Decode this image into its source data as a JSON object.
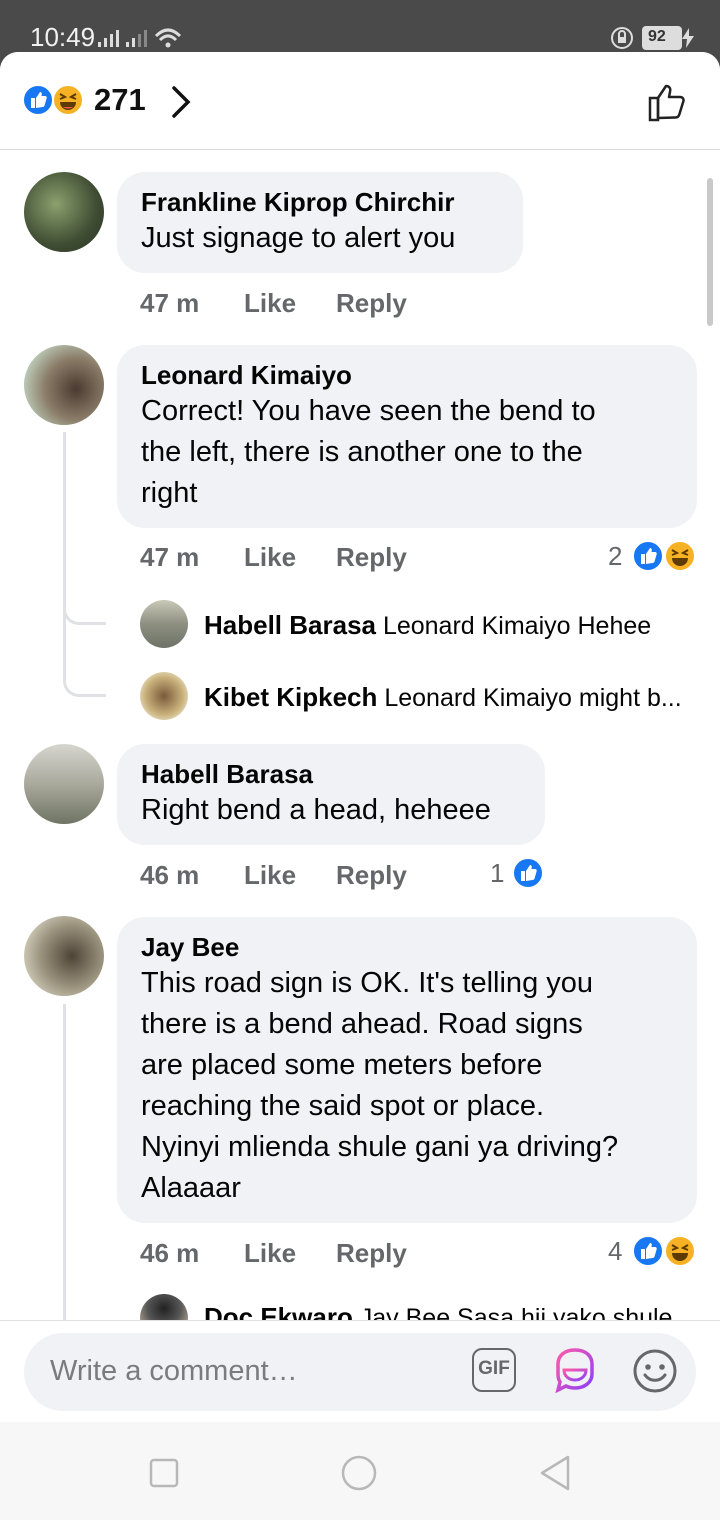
{
  "status": {
    "time": "10:49",
    "battery": "92"
  },
  "header": {
    "reaction_count": "271"
  },
  "comments": [
    {
      "author": "Frankline Kiprop Chirchir",
      "text": "Just signage to alert you",
      "time": "47 m",
      "like": "Like",
      "reply": "Reply"
    },
    {
      "author": "Leonard Kimaiyo",
      "text_lines": [
        "Correct! You have seen the bend to",
        "the left, there is another one to the",
        "right"
      ],
      "time": "47 m",
      "like": "Like",
      "reply": "Reply",
      "reactions": "2",
      "replies": [
        {
          "author": "Habell Barasa",
          "text": "Leonard Kimaiyo Hehee"
        },
        {
          "author": "Kibet Kipkech",
          "text": "Leonard Kimaiyo might b..."
        }
      ]
    },
    {
      "author": "Habell Barasa",
      "text": "Right bend a head, heheee",
      "time": "46 m",
      "like": "Like",
      "reply": "Reply",
      "reactions": "1"
    },
    {
      "author": "Jay Bee",
      "text_lines": [
        "This road sign is OK.  It's telling you",
        "there is a bend ahead. Road signs",
        "are placed some meters before",
        "reaching the said spot or place.",
        "Nyinyi mlienda shule gani ya driving?",
        "Alaaaar"
      ],
      "time": "46 m",
      "like": "Like",
      "reply": "Reply",
      "reactions": "4",
      "replies": [
        {
          "author": "Doc Ekwaro",
          "text": "Jay Bee Sasa hii yako shule"
        }
      ]
    }
  ],
  "composer": {
    "placeholder": "Write a comment…",
    "gif_label": "GIF"
  },
  "colors": {
    "like_blue": "#1877f2",
    "haha_yellow": "#f7b125",
    "bubble": "#f0f2f5"
  }
}
